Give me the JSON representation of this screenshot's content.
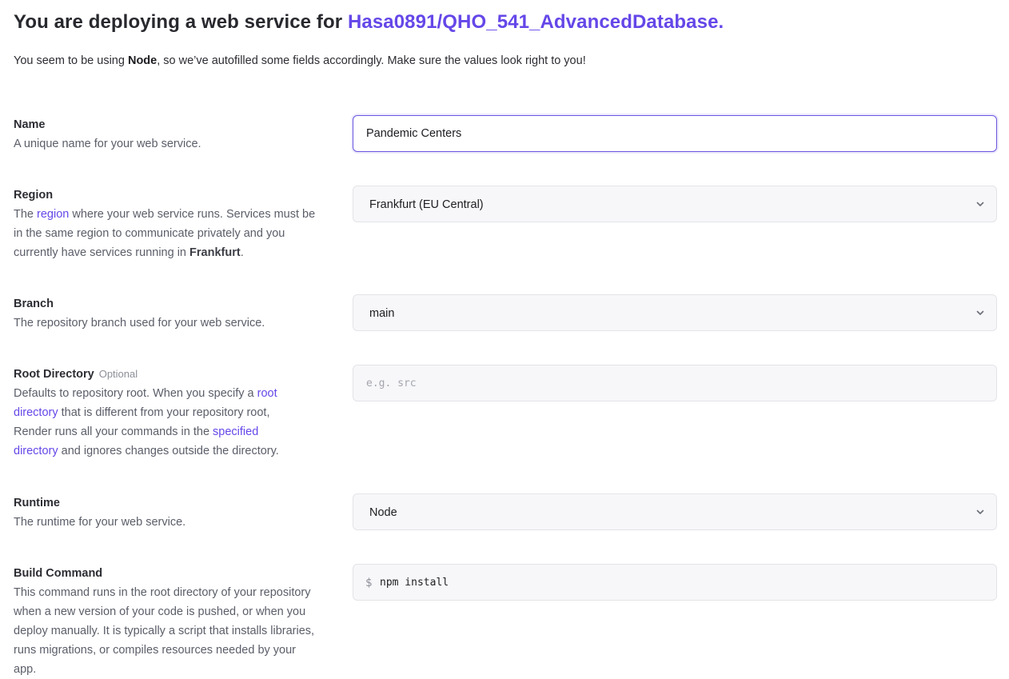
{
  "header": {
    "title_prefix": "You are deploying a web service for ",
    "repo_name": "Hasa0891/QHO_541_AdvancedDatabase.",
    "subtitle_pre": "You seem to be using ",
    "subtitle_runtime": "Node",
    "subtitle_post": ", so we’ve autofilled some fields accordingly. Make sure the values look right to you!"
  },
  "fields": {
    "name": {
      "label": "Name",
      "description": "A unique name for your web service.",
      "value": "Pandemic Centers"
    },
    "region": {
      "label": "Region",
      "desc_pre": "The ",
      "desc_link": "region",
      "desc_mid": " where your web service runs. Services must be in the same region to communicate privately and you currently have services running in ",
      "desc_bold": "Frankfurt",
      "desc_post": ".",
      "selected": "Frankfurt (EU Central)"
    },
    "branch": {
      "label": "Branch",
      "description": "The repository branch used for your web service.",
      "selected": "main"
    },
    "root_directory": {
      "label": "Root Directory",
      "optional": "Optional",
      "desc_pre": "Defaults to repository root. When you specify a ",
      "desc_link1": "root directory",
      "desc_mid": " that is different from your repository root, Render runs all your commands in the ",
      "desc_link2": "specified directory",
      "desc_post": " and ignores changes outside the directory.",
      "placeholder": "e.g. src",
      "value": ""
    },
    "runtime": {
      "label": "Runtime",
      "description": "The runtime for your web service.",
      "selected": "Node"
    },
    "build_command": {
      "label": "Build Command",
      "description": "This command runs in the root directory of your repository when a new version of your code is pushed, or when you deploy manually. It is typically a script that installs libraries, runs migrations, or compiles resources needed by your app.",
      "prefix": "$",
      "value": "npm install"
    }
  },
  "icons": {
    "select_chevron": "chevron-down-icon"
  },
  "colors": {
    "accent": "#6547e8",
    "focus_border": "#6b57e0",
    "input_bg": "#f7f7f9",
    "input_border": "#e3e4e8"
  }
}
